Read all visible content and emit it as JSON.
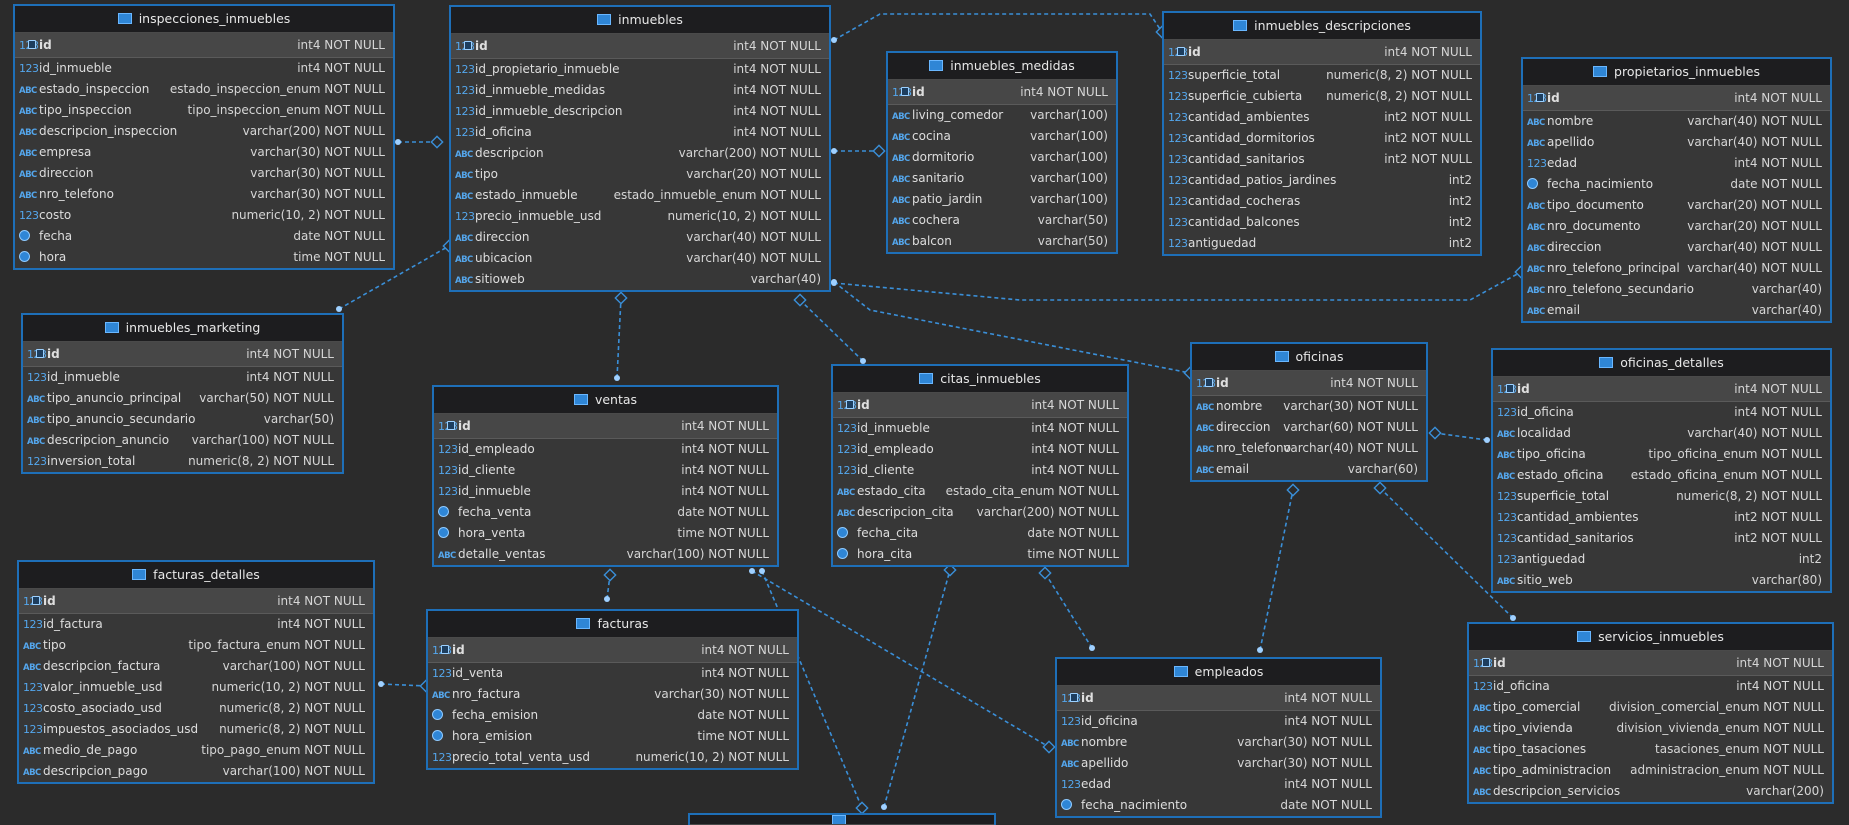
{
  "theme": {
    "background": "#2b2b2b",
    "entity_border": "#1e6fb8",
    "link_color": "#3a8fd8",
    "icon_color": "#54a6ec"
  },
  "entities": {
    "inspecciones_inmuebles": {
      "title": "inspecciones_inmuebles",
      "columns": [
        {
          "name": "id",
          "type": "int4 NOT NULL",
          "icon": "key-icon",
          "pk": true
        },
        {
          "name": "id_inmueble",
          "type": "int4 NOT NULL",
          "icon": "number-icon"
        },
        {
          "name": "estado_inspeccion",
          "type": "estado_inspeccion_enum NOT NULL",
          "icon": "text-icon"
        },
        {
          "name": "tipo_inspeccion",
          "type": "tipo_inspeccion_enum NOT NULL",
          "icon": "text-icon"
        },
        {
          "name": "descripcion_inspeccion",
          "type": "varchar(200) NOT NULL",
          "icon": "text-icon"
        },
        {
          "name": "empresa",
          "type": "varchar(30) NOT NULL",
          "icon": "text-icon"
        },
        {
          "name": "direccion",
          "type": "varchar(30) NOT NULL",
          "icon": "text-icon"
        },
        {
          "name": "nro_telefono",
          "type": "varchar(30) NOT NULL",
          "icon": "text-icon"
        },
        {
          "name": "costo",
          "type": "numeric(10, 2) NOT NULL",
          "icon": "number-icon"
        },
        {
          "name": "fecha",
          "type": "date NOT NULL",
          "icon": "clock-icon"
        },
        {
          "name": "hora",
          "type": "time NOT NULL",
          "icon": "clock-icon"
        }
      ]
    },
    "inmuebles": {
      "title": "inmuebles",
      "columns": [
        {
          "name": "id",
          "type": "int4 NOT NULL",
          "icon": "key-icon",
          "pk": true
        },
        {
          "name": "id_propietario_inmueble",
          "type": "int4 NOT NULL",
          "icon": "number-icon"
        },
        {
          "name": "id_inmueble_medidas",
          "type": "int4 NOT NULL",
          "icon": "number-icon"
        },
        {
          "name": "id_inmueble_descripcion",
          "type": "int4 NOT NULL",
          "icon": "number-icon"
        },
        {
          "name": "id_oficina",
          "type": "int4 NOT NULL",
          "icon": "number-icon"
        },
        {
          "name": "descripcion",
          "type": "varchar(200) NOT NULL",
          "icon": "text-icon"
        },
        {
          "name": "tipo",
          "type": "varchar(20) NOT NULL",
          "icon": "text-icon"
        },
        {
          "name": "estado_inmueble",
          "type": "estado_inmueble_enum NOT NULL",
          "icon": "text-icon"
        },
        {
          "name": "precio_inmueble_usd",
          "type": "numeric(10, 2) NOT NULL",
          "icon": "number-icon"
        },
        {
          "name": "direccion",
          "type": "varchar(40) NOT NULL",
          "icon": "text-icon"
        },
        {
          "name": "ubicacion",
          "type": "varchar(40) NOT NULL",
          "icon": "text-icon"
        },
        {
          "name": "sitioweb",
          "type": "varchar(40)",
          "icon": "text-icon"
        }
      ]
    },
    "inmuebles_medidas": {
      "title": "inmuebles_medidas",
      "columns": [
        {
          "name": "id",
          "type": "int4 NOT NULL",
          "icon": "key-icon",
          "pk": true
        },
        {
          "name": "living_comedor",
          "type": "varchar(100)",
          "icon": "text-icon"
        },
        {
          "name": "cocina",
          "type": "varchar(100)",
          "icon": "text-icon"
        },
        {
          "name": "dormitorio",
          "type": "varchar(100)",
          "icon": "text-icon"
        },
        {
          "name": "sanitario",
          "type": "varchar(100)",
          "icon": "text-icon"
        },
        {
          "name": "patio_jardin",
          "type": "varchar(100)",
          "icon": "text-icon"
        },
        {
          "name": "cochera",
          "type": "varchar(50)",
          "icon": "text-icon"
        },
        {
          "name": "balcon",
          "type": "varchar(50)",
          "icon": "text-icon"
        }
      ]
    },
    "inmuebles_descripciones": {
      "title": "inmuebles_descripciones",
      "columns": [
        {
          "name": "id",
          "type": "int4 NOT NULL",
          "icon": "key-icon",
          "pk": true
        },
        {
          "name": "superficie_total",
          "type": "numeric(8, 2) NOT NULL",
          "icon": "number-icon"
        },
        {
          "name": "superficie_cubierta",
          "type": "numeric(8, 2) NOT NULL",
          "icon": "number-icon"
        },
        {
          "name": "cantidad_ambientes",
          "type": "int2 NOT NULL",
          "icon": "number-icon"
        },
        {
          "name": "cantidad_dormitorios",
          "type": "int2 NOT NULL",
          "icon": "number-icon"
        },
        {
          "name": "cantidad_sanitarios",
          "type": "int2 NOT NULL",
          "icon": "number-icon"
        },
        {
          "name": "cantidad_patios_jardines",
          "type": "int2",
          "icon": "number-icon"
        },
        {
          "name": "cantidad_cocheras",
          "type": "int2",
          "icon": "number-icon"
        },
        {
          "name": "cantidad_balcones",
          "type": "int2",
          "icon": "number-icon"
        },
        {
          "name": "antiguedad",
          "type": "int2",
          "icon": "number-icon"
        }
      ]
    },
    "propietarios_inmuebles": {
      "title": "propietarios_inmuebles",
      "columns": [
        {
          "name": "id",
          "type": "int4 NOT NULL",
          "icon": "key-icon",
          "pk": true
        },
        {
          "name": "nombre",
          "type": "varchar(40) NOT NULL",
          "icon": "text-icon"
        },
        {
          "name": "apellido",
          "type": "varchar(40) NOT NULL",
          "icon": "text-icon"
        },
        {
          "name": "edad",
          "type": "int4 NOT NULL",
          "icon": "number-icon"
        },
        {
          "name": "fecha_nacimiento",
          "type": "date NOT NULL",
          "icon": "clock-icon"
        },
        {
          "name": "tipo_documento",
          "type": "varchar(20) NOT NULL",
          "icon": "text-icon"
        },
        {
          "name": "nro_documento",
          "type": "varchar(20) NOT NULL",
          "icon": "text-icon"
        },
        {
          "name": "direccion",
          "type": "varchar(40) NOT NULL",
          "icon": "text-icon"
        },
        {
          "name": "nro_telefono_principal",
          "type": "varchar(40) NOT NULL",
          "icon": "text-icon"
        },
        {
          "name": "nro_telefono_secundario",
          "type": "varchar(40)",
          "icon": "text-icon"
        },
        {
          "name": "email",
          "type": "varchar(40)",
          "icon": "text-icon"
        }
      ]
    },
    "inmuebles_marketing": {
      "title": "inmuebles_marketing",
      "columns": [
        {
          "name": "id",
          "type": "int4 NOT NULL",
          "icon": "key-icon",
          "pk": true
        },
        {
          "name": "id_inmueble",
          "type": "int4 NOT NULL",
          "icon": "number-icon"
        },
        {
          "name": "tipo_anuncio_principal",
          "type": "varchar(50) NOT NULL",
          "icon": "text-icon"
        },
        {
          "name": "tipo_anuncio_secundario",
          "type": "varchar(50)",
          "icon": "text-icon"
        },
        {
          "name": "descripcion_anuncio",
          "type": "varchar(100) NOT NULL",
          "icon": "text-icon"
        },
        {
          "name": "inversion_total",
          "type": "numeric(8, 2) NOT NULL",
          "icon": "number-icon"
        }
      ]
    },
    "ventas": {
      "title": "ventas",
      "columns": [
        {
          "name": "id",
          "type": "int4 NOT NULL",
          "icon": "key-icon",
          "pk": true
        },
        {
          "name": "id_empleado",
          "type": "int4 NOT NULL",
          "icon": "number-icon"
        },
        {
          "name": "id_cliente",
          "type": "int4 NOT NULL",
          "icon": "number-icon"
        },
        {
          "name": "id_inmueble",
          "type": "int4 NOT NULL",
          "icon": "number-icon"
        },
        {
          "name": "fecha_venta",
          "type": "date NOT NULL",
          "icon": "clock-icon"
        },
        {
          "name": "hora_venta",
          "type": "time NOT NULL",
          "icon": "clock-icon"
        },
        {
          "name": "detalle_ventas",
          "type": "varchar(100) NOT NULL",
          "icon": "text-icon"
        }
      ]
    },
    "citas_inmuebles": {
      "title": "citas_inmuebles",
      "columns": [
        {
          "name": "id",
          "type": "int4 NOT NULL",
          "icon": "key-icon",
          "pk": true
        },
        {
          "name": "id_inmueble",
          "type": "int4 NOT NULL",
          "icon": "number-icon"
        },
        {
          "name": "id_empleado",
          "type": "int4 NOT NULL",
          "icon": "number-icon"
        },
        {
          "name": "id_cliente",
          "type": "int4 NOT NULL",
          "icon": "number-icon"
        },
        {
          "name": "estado_cita",
          "type": "estado_cita_enum NOT NULL",
          "icon": "text-icon"
        },
        {
          "name": "descripcion_cita",
          "type": "varchar(200) NOT NULL",
          "icon": "text-icon"
        },
        {
          "name": "fecha_cita",
          "type": "date NOT NULL",
          "icon": "clock-icon"
        },
        {
          "name": "hora_cita",
          "type": "time NOT NULL",
          "icon": "clock-icon"
        }
      ]
    },
    "oficinas": {
      "title": "oficinas",
      "columns": [
        {
          "name": "id",
          "type": "int4 NOT NULL",
          "icon": "key-icon",
          "pk": true
        },
        {
          "name": "nombre",
          "type": "varchar(30) NOT NULL",
          "icon": "text-icon"
        },
        {
          "name": "direccion",
          "type": "varchar(60) NOT NULL",
          "icon": "text-icon"
        },
        {
          "name": "nro_telefono",
          "type": "varchar(40) NOT NULL",
          "icon": "text-icon"
        },
        {
          "name": "email",
          "type": "varchar(60)",
          "icon": "text-icon"
        }
      ]
    },
    "oficinas_detalles": {
      "title": "oficinas_detalles",
      "columns": [
        {
          "name": "id",
          "type": "int4 NOT NULL",
          "icon": "key-icon",
          "pk": true
        },
        {
          "name": "id_oficina",
          "type": "int4 NOT NULL",
          "icon": "number-icon"
        },
        {
          "name": "localidad",
          "type": "varchar(40) NOT NULL",
          "icon": "text-icon"
        },
        {
          "name": "tipo_oficina",
          "type": "tipo_oficina_enum NOT NULL",
          "icon": "text-icon"
        },
        {
          "name": "estado_oficina",
          "type": "estado_oficina_enum NOT NULL",
          "icon": "text-icon"
        },
        {
          "name": "superficie_total",
          "type": "numeric(8, 2) NOT NULL",
          "icon": "number-icon"
        },
        {
          "name": "cantidad_ambientes",
          "type": "int2 NOT NULL",
          "icon": "number-icon"
        },
        {
          "name": "cantidad_sanitarios",
          "type": "int2 NOT NULL",
          "icon": "number-icon"
        },
        {
          "name": "antiguedad",
          "type": "int2",
          "icon": "number-icon"
        },
        {
          "name": "sitio_web",
          "type": "varchar(80)",
          "icon": "text-icon"
        }
      ]
    },
    "facturas_detalles": {
      "title": "facturas_detalles",
      "columns": [
        {
          "name": "id",
          "type": "int4 NOT NULL",
          "icon": "key-icon",
          "pk": true
        },
        {
          "name": "id_factura",
          "type": "int4 NOT NULL",
          "icon": "number-icon"
        },
        {
          "name": "tipo",
          "type": "tipo_factura_enum NOT NULL",
          "icon": "text-icon"
        },
        {
          "name": "descripcion_factura",
          "type": "varchar(100) NOT NULL",
          "icon": "text-icon"
        },
        {
          "name": "valor_inmueble_usd",
          "type": "numeric(10, 2) NOT NULL",
          "icon": "number-icon"
        },
        {
          "name": "costo_asociado_usd",
          "type": "numeric(8, 2) NOT NULL",
          "icon": "number-icon"
        },
        {
          "name": "impuestos_asociados_usd",
          "type": "numeric(8, 2) NOT NULL",
          "icon": "number-icon"
        },
        {
          "name": "medio_de_pago",
          "type": "tipo_pago_enum NOT NULL",
          "icon": "text-icon"
        },
        {
          "name": "descripcion_pago",
          "type": "varchar(100) NOT NULL",
          "icon": "text-icon"
        }
      ]
    },
    "facturas": {
      "title": "facturas",
      "columns": [
        {
          "name": "id",
          "type": "int4 NOT NULL",
          "icon": "key-icon",
          "pk": true
        },
        {
          "name": "id_venta",
          "type": "int4 NOT NULL",
          "icon": "number-icon"
        },
        {
          "name": "nro_factura",
          "type": "varchar(30) NOT NULL",
          "icon": "text-icon"
        },
        {
          "name": "fecha_emision",
          "type": "date NOT NULL",
          "icon": "clock-icon"
        },
        {
          "name": "hora_emision",
          "type": "time NOT NULL",
          "icon": "clock-icon"
        },
        {
          "name": "precio_total_venta_usd",
          "type": "numeric(10, 2) NOT NULL",
          "icon": "number-icon"
        }
      ]
    },
    "empleados": {
      "title": "empleados",
      "columns": [
        {
          "name": "id",
          "type": "int4 NOT NULL",
          "icon": "key-icon",
          "pk": true
        },
        {
          "name": "id_oficina",
          "type": "int4 NOT NULL",
          "icon": "number-icon"
        },
        {
          "name": "nombre",
          "type": "varchar(30) NOT NULL",
          "icon": "text-icon"
        },
        {
          "name": "apellido",
          "type": "varchar(30) NOT NULL",
          "icon": "text-icon"
        },
        {
          "name": "edad",
          "type": "int4 NOT NULL",
          "icon": "number-icon"
        },
        {
          "name": "fecha_nacimiento",
          "type": "date NOT NULL",
          "icon": "clock-icon"
        }
      ]
    },
    "servicios_inmuebles": {
      "title": "servicios_inmuebles",
      "columns": [
        {
          "name": "id",
          "type": "int4 NOT NULL",
          "icon": "key-icon",
          "pk": true
        },
        {
          "name": "id_oficina",
          "type": "int4 NOT NULL",
          "icon": "number-icon"
        },
        {
          "name": "tipo_comercial",
          "type": "division_comercial_enum NOT NULL",
          "icon": "text-icon"
        },
        {
          "name": "tipo_vivienda",
          "type": "division_vivienda_enum NOT NULL",
          "icon": "text-icon"
        },
        {
          "name": "tipo_tasaciones",
          "type": "tasaciones_enum NOT NULL",
          "icon": "text-icon"
        },
        {
          "name": "tipo_administracion",
          "type": "administracion_enum NOT NULL",
          "icon": "text-icon"
        },
        {
          "name": "descripcion_servicios",
          "type": "varchar(200)",
          "icon": "text-icon"
        }
      ]
    },
    "unnamed_bottom": {
      "title": "",
      "columns": []
    }
  }
}
